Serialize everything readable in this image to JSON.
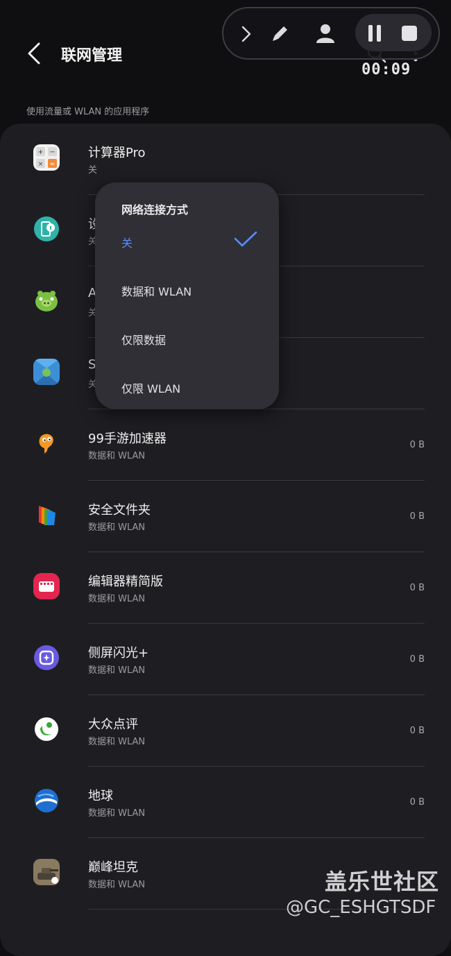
{
  "header": {
    "title": "联网管理",
    "section_label": "使用流量或 WLAN 的应用程序"
  },
  "recorder": {
    "timer": "00:09"
  },
  "apps": [
    {
      "name": "计算器Pro",
      "status": "关",
      "size": "",
      "icon": "calculator-icon"
    },
    {
      "name": "设",
      "status": "关",
      "size": "",
      "icon": "device-info-icon"
    },
    {
      "name": "A",
      "status": "关",
      "size": "",
      "icon": "angry-birds-pig-icon"
    },
    {
      "name": "S",
      "status": "关",
      "size": "",
      "icon": "android-map-icon"
    },
    {
      "name": "99手游加速器",
      "status": "数据和 WLAN",
      "size": "0 B",
      "icon": "game-accelerator-icon"
    },
    {
      "name": "安全文件夹",
      "status": "数据和 WLAN",
      "size": "0 B",
      "icon": "secure-folder-icon"
    },
    {
      "name": "编辑器精简版",
      "status": "数据和 WLAN",
      "size": "0 B",
      "icon": "video-editor-icon"
    },
    {
      "name": "侧屏闪光+",
      "status": "数据和 WLAN",
      "size": "0 B",
      "icon": "edge-lighting-icon"
    },
    {
      "name": "大众点评",
      "status": "数据和 WLAN",
      "size": "0 B",
      "icon": "dianping-icon"
    },
    {
      "name": "地球",
      "status": "数据和 WLAN",
      "size": "0 B",
      "icon": "google-earth-icon"
    },
    {
      "name": "巅峰坦克",
      "status": "数据和 WLAN",
      "size": "",
      "icon": "tank-game-icon"
    }
  ],
  "popup": {
    "title": "网络连接方式",
    "options": [
      "关",
      "数据和 WLAN",
      "仅限数据",
      "仅限 WLAN"
    ],
    "selected_index": 0
  },
  "watermark": {
    "line1": "盖乐世社区",
    "line2": "@GC_ESHGTSDF"
  },
  "colors": {
    "accent": "#5b8cff",
    "background": "#0f0f11",
    "card": "#1e1e22",
    "popup": "#2f2f35"
  }
}
